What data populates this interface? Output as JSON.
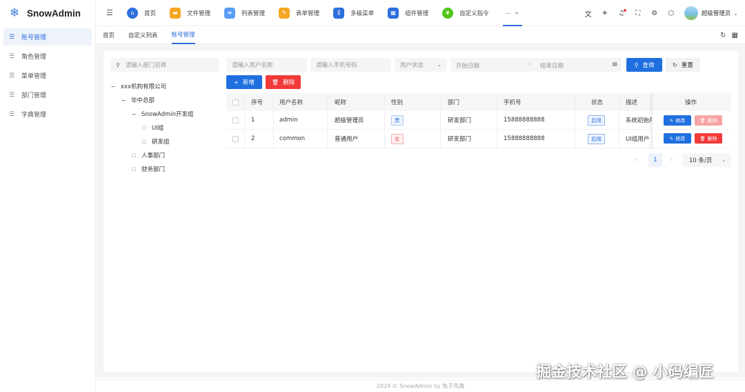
{
  "app": {
    "title": "SnowAdmin"
  },
  "sidebar": {
    "items": [
      {
        "label": "账号管理",
        "active": true
      },
      {
        "label": "角色管理"
      },
      {
        "label": "菜单管理"
      },
      {
        "label": "部门管理"
      },
      {
        "label": "字典管理"
      }
    ]
  },
  "topnav": {
    "items": [
      {
        "label": "首页",
        "icon": "home-icon",
        "color": "#2d6fdc"
      },
      {
        "label": "文件管理",
        "icon": "folder-icon",
        "color": "#f5a623"
      },
      {
        "label": "列表管理",
        "icon": "list-icon",
        "color": "#5b9cf5"
      },
      {
        "label": "表单管理",
        "icon": "form-icon",
        "color": "#f5a623"
      },
      {
        "label": "多级菜单",
        "icon": "equalizer-icon",
        "color": "#2d6fdc"
      },
      {
        "label": "组件管理",
        "icon": "grid-icon",
        "color": "#2d6fdc"
      },
      {
        "label": "自定义指令",
        "icon": "leaf-icon",
        "color": "#52c41a"
      }
    ],
    "more": "..."
  },
  "header": {
    "username": "超级管理员"
  },
  "tabs": [
    {
      "label": "首页"
    },
    {
      "label": "自定义列表"
    },
    {
      "label": "账号管理",
      "active": true
    }
  ],
  "dept": {
    "search_placeholder": "请输入部门名称",
    "tree": {
      "root": "xxx机构有限公司",
      "hq": "华中总部",
      "devgroup": "SnowAdmin开发组",
      "ui": "UI组",
      "rd": "研发组",
      "hr": "人事部门",
      "finance": "财务部门"
    }
  },
  "filters": {
    "username_placeholder": "请输入用户名称",
    "phone_placeholder": "请输入手机号码",
    "status_placeholder": "用户状态",
    "start_date": "开始日期",
    "date_sep": "-",
    "end_date": "结束日期",
    "search": "查询",
    "reset": "重置"
  },
  "actions": {
    "add": "新增",
    "delete": "删除"
  },
  "table": {
    "headers": {
      "index": "序号",
      "username": "用户名称",
      "nickname": "昵称",
      "gender": "性别",
      "dept": "部门",
      "phone": "手机号",
      "status": "状态",
      "desc": "描述",
      "ops": "操作"
    },
    "rows": [
      {
        "index": "1",
        "username": "admin",
        "nickname": "超级管理员",
        "gender": "男",
        "dept": "研发部门",
        "phone": "15888888888",
        "status": "启用",
        "desc": "系统初始用户"
      },
      {
        "index": "2",
        "username": "common",
        "nickname": "普通用户",
        "gender": "女",
        "dept": "研发部门",
        "phone": "15888888888",
        "status": "启用",
        "desc": "UI组用户"
      }
    ],
    "edit": "修改",
    "del": "删除"
  },
  "pagination": {
    "current": "1",
    "page_size": "10 条/页"
  },
  "footer": "2024 © SnowAdmin by 兔子先森",
  "watermark": "掘金技术社区 @ 小码编匠"
}
